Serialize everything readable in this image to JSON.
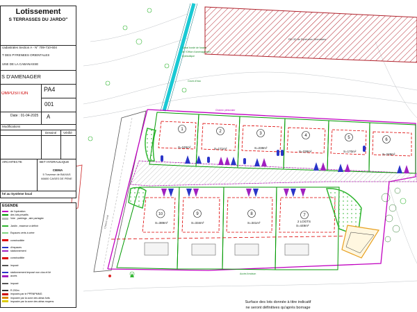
{
  "title_block": {
    "title": "Lotissement",
    "project": "S TERRASSES DU JARDO\"",
    "cadastre": "cadastrales Section A - N° 709-710-604",
    "department": "T DES PYRENEES ORIENTALES",
    "commune": "UNE DE LA CABANASSE",
    "doc_type": "S D'AMENAGER",
    "sheet_code": "PA4",
    "sheet_label": "OMPOSITION",
    "index": "001",
    "date": "Date : 01-04-2025",
    "revision": "A",
    "modifications_label": "Modifications",
    "col_dessine": "Dessiné",
    "col_verifie": "Vérifié",
    "architect_label": "ARCHITECTE",
    "bet_label": "BET HYDRAULIQUE",
    "bet_name": "CIEMA",
    "bet_address_1": "5 Traverse de BAIXAS",
    "bet_address_2": "66600 CASES DE PENE",
    "system_note": "hé au Système local"
  },
  "legend": {
    "title": "EGENDE",
    "items": [
      "de l'opération",
      "des lots privatifs",
      "Voie , parkings , aire partagée",
      "",
      "Jardin , essence à définir",
      "",
      "Espaces verts à créer",
      "",
      "constructible",
      "",
      "d'espaces",
      "stationnement",
      "",
      "constructible",
      "",
      "imposé",
      "",
      "stationnement imposé non clos et lié",
      "accès",
      "",
      "imposé",
      "",
      "R.200m",
      "imposés par le PPRNPMMG",
      "imposée par la zone des aléas forts",
      "imposée par la zone des aléas moyens"
    ]
  },
  "annotations": {
    "route_label": "RD 32 de Pyrénées Orientales",
    "canal_label_1": "Canal bordé de fossés",
    "canal_label_2": "de l'Office d'aménagement",
    "canal_label_3": "hydraulique",
    "canal_label_4": "Cours d'eau",
    "road_label": "Chemin rural",
    "passage_label": "Chemin piétonnier",
    "access_label": "Accès livraison",
    "surface_note_1": "Surface des lots donnée à titre indicatif",
    "surface_note_2": "ne seront définitives qu'après bornage"
  },
  "lots": [
    {
      "number": "1",
      "surface": "S=245m²"
    },
    {
      "number": "2",
      "surface": "S=171m²"
    },
    {
      "number": "3",
      "surface": "S=238m²"
    },
    {
      "number": "4",
      "surface": "S=238m²"
    },
    {
      "number": "5",
      "surface": "S=170m²"
    },
    {
      "number": "6",
      "surface": "S=248m²"
    },
    {
      "number": "7",
      "surface": "S=449m²",
      "extra": "2 LOGTS"
    },
    {
      "number": "8",
      "surface": "S=341m²"
    },
    {
      "number": "9",
      "surface": "S=334m²"
    },
    {
      "number": "10",
      "surface": "S=389m²"
    }
  ],
  "colors": {
    "perimeter": "#c000c0",
    "lot_border": "#009900",
    "building_zone": "#dd0000",
    "canal": "#19c9d4",
    "parking_blue": "#2a35c8",
    "parking_purple": "#a020c0",
    "garden": "#2fb52f",
    "hatch": "#b0202a",
    "shared_area": "#e8a020"
  }
}
